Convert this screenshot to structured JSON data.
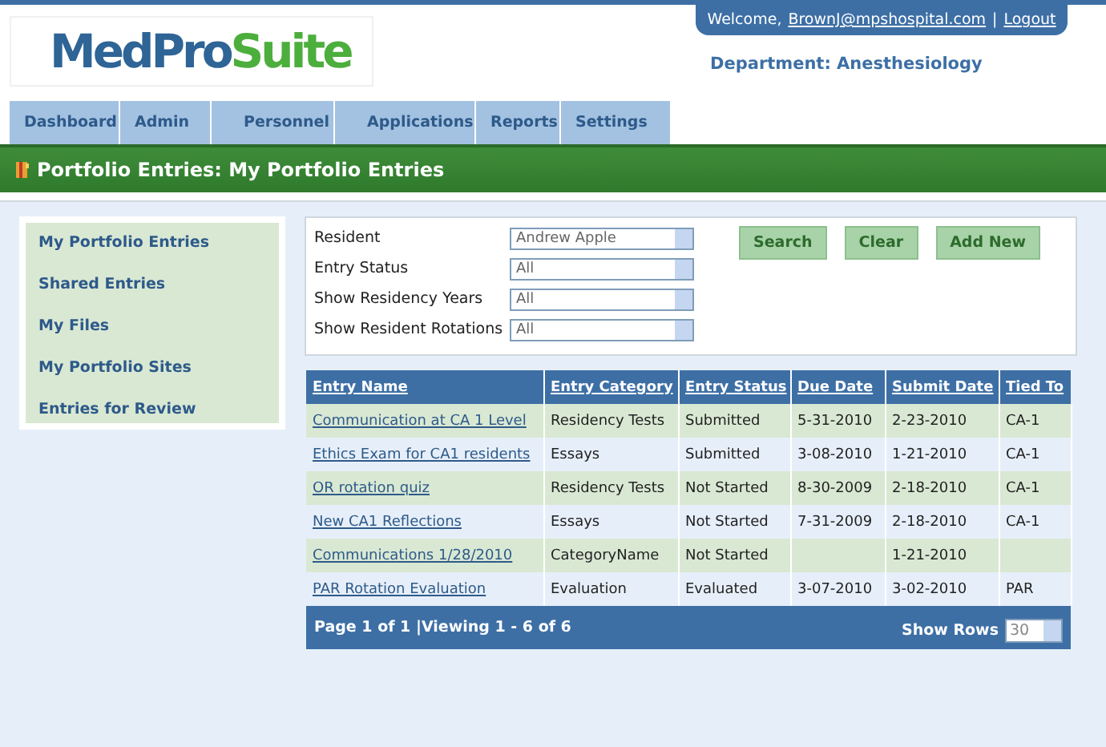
{
  "header": {
    "logo": {
      "part_1": "MedPro",
      "part_2": "Suite"
    },
    "welcome": "Welcome,",
    "user_email": "BrownJ@mpshospital.com",
    "separator": "|",
    "logout": "Logout",
    "department": "Department: Anesthesiology"
  },
  "nav_tabs": [
    "Dashboard",
    "Admin",
    "Personnel",
    "Applications",
    "Reports",
    "Settings"
  ],
  "page_title": "Portfolio Entries: My Portfolio Entries",
  "sidebar": {
    "items": [
      "My Portfolio Entries",
      "Shared Entries",
      "My Files",
      "My Portfolio Sites",
      "Entries for Review"
    ]
  },
  "filters": [
    {
      "label": "Resident",
      "value": "Andrew Apple"
    },
    {
      "label": "Entry Status",
      "value": "All"
    },
    {
      "label": "Show Residency Years",
      "value": "All"
    },
    {
      "label": "Show Resident Rotations",
      "value": "All"
    }
  ],
  "buttons": [
    "Search",
    "Clear",
    "Add New"
  ],
  "table": {
    "columns": [
      "Entry Name",
      "Entry Category",
      "Entry Status",
      "Due Date",
      "Submit Date",
      "Tied To"
    ],
    "rows": [
      {
        "entry_name": "Communication at CA 1 Level",
        "category": "Residency Tests",
        "status": "Submitted",
        "due_date": "5-31-2010",
        "submit_date": "2-23-2010",
        "tied_to": "CA-1"
      },
      {
        "entry_name": "Ethics Exam for CA1 residents",
        "category": "Essays",
        "status": "Submitted",
        "due_date": "3-08-2010",
        "submit_date": "1-21-2010",
        "tied_to": "CA-1"
      },
      {
        "entry_name": "OR rotation quiz",
        "category": "Residency Tests",
        "status": "Not Started",
        "due_date": "8-30-2009",
        "submit_date": "2-18-2010",
        "tied_to": "CA-1"
      },
      {
        "entry_name": "New CA1 Reflections",
        "category": "Essays",
        "status": "Not Started",
        "due_date": "7-31-2009",
        "submit_date": "2-18-2010",
        "tied_to": "CA-1"
      },
      {
        "entry_name": "Communications 1/28/2010",
        "category": "CategoryName",
        "status": "Not Started",
        "submit_date": "1-21-2010"
      },
      {
        "entry_name": "PAR Rotation Evaluation",
        "category": "Evaluation",
        "status": "Evaluated",
        "due_date": "3-07-2010",
        "submit_date": "3-02-2010",
        "tied_to": "PAR"
      }
    ]
  },
  "footer": {
    "pager": "Page 1 of 1 |Viewing 1 - 6 of 6",
    "rows_label": "Show Rows",
    "rows_value": "30"
  }
}
